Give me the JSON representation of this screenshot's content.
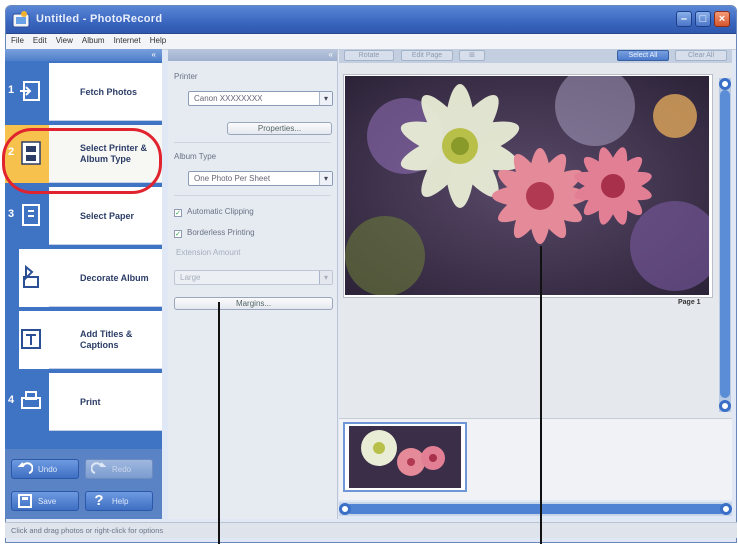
{
  "window": {
    "title": "Untitled - PhotoRecord"
  },
  "menu": [
    "File",
    "Edit",
    "View",
    "Album",
    "Internet",
    "Help"
  ],
  "steps": [
    {
      "num": "1",
      "label": "Fetch Photos"
    },
    {
      "num": "2",
      "label": "Select Printer & Album Type"
    },
    {
      "num": "3",
      "label": "Select Paper"
    },
    {
      "num": "",
      "label": "Decorate Album"
    },
    {
      "num": "",
      "label": "Add Titles & Captions"
    },
    {
      "num": "4",
      "label": "Print"
    }
  ],
  "bottom_buttons": {
    "undo": "Undo",
    "redo": "Redo",
    "save": "Save",
    "help": "Help"
  },
  "settings": {
    "printer_label": "Printer",
    "printer_value": "Canon XXXXXXXX",
    "properties": "Properties...",
    "album_type_label": "Album Type",
    "album_type_value": "One Photo Per Sheet",
    "automatic_clipping": "Automatic Clipping",
    "borderless_printing": "Borderless Printing",
    "extension_label": "Extension Amount",
    "extension_value": "Large",
    "margins": "Margins..."
  },
  "toolbar": {
    "btn1": "Rotate",
    "btn2": "Edit Page",
    "select_all": "Select All",
    "deselect": "Clear All"
  },
  "preview": {
    "page_label": "Page 1"
  },
  "status": {
    "text": "Click and drag photos or right-click for options"
  }
}
